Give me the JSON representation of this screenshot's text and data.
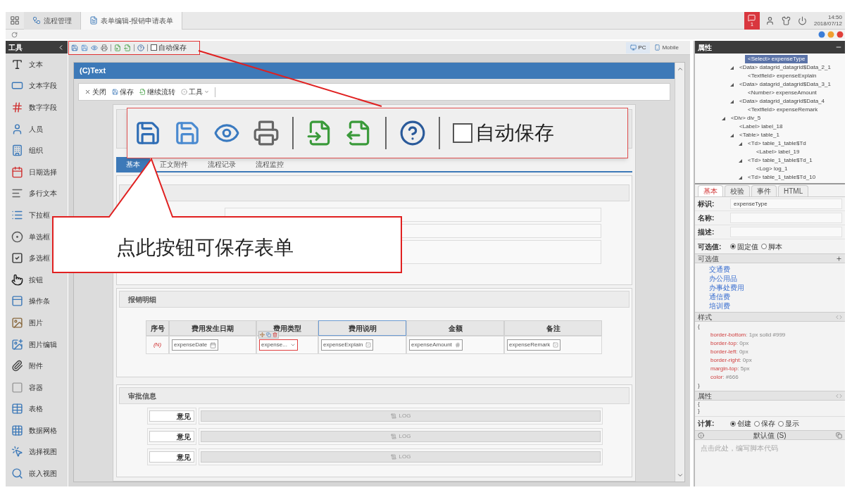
{
  "top_bar": {
    "tabs": [
      {
        "label": "流程管理",
        "selected": false,
        "kind": "flow"
      },
      {
        "label": "表单编辑-报销申请表单",
        "selected": true,
        "kind": "form"
      }
    ],
    "notification_count": "1",
    "time": "14:50",
    "date": "2018/07/12"
  },
  "toolbox": {
    "title": "工具",
    "items": [
      {
        "label": "文本",
        "kind": "text"
      },
      {
        "label": "文本字段",
        "kind": "textfield"
      },
      {
        "label": "数字字段",
        "kind": "number"
      },
      {
        "label": "人员",
        "kind": "person"
      },
      {
        "label": "组织",
        "kind": "org"
      },
      {
        "label": "日期选择",
        "kind": "date"
      },
      {
        "label": "多行文本",
        "kind": "textarea"
      },
      {
        "label": "下拉框",
        "kind": "dropdown"
      },
      {
        "label": "单选框",
        "kind": "radio"
      },
      {
        "label": "多选框",
        "kind": "checkbox"
      },
      {
        "label": "按钮",
        "kind": "button"
      },
      {
        "label": "操作条",
        "kind": "actionbar"
      },
      {
        "label": "图片",
        "kind": "image"
      },
      {
        "label": "图片编辑",
        "kind": "imageedit"
      },
      {
        "label": "附件",
        "kind": "attachment"
      },
      {
        "label": "容器",
        "kind": "container"
      },
      {
        "label": "表格",
        "kind": "table"
      },
      {
        "label": "数据网格",
        "kind": "datagrid"
      },
      {
        "label": "选择视图",
        "kind": "selectview"
      },
      {
        "label": "嵌入视图",
        "kind": "embedview"
      }
    ]
  },
  "editor_toolbar": {
    "auto_save": {
      "label": "自动保存",
      "checked": false
    },
    "views": [
      {
        "label": "PC",
        "selected": true
      },
      {
        "label": "Mobile",
        "selected": false
      }
    ]
  },
  "form": {
    "title": "(C)Text",
    "actions": [
      {
        "label": "关闭",
        "kind": "close"
      },
      {
        "label": "保存",
        "kind": "save"
      },
      {
        "label": "继续流转",
        "kind": "flow"
      },
      {
        "label": "工具",
        "kind": "menu"
      }
    ],
    "tabs": [
      {
        "label": "基本",
        "selected": true
      },
      {
        "label": "正文附件",
        "selected": false
      },
      {
        "label": "流程记录",
        "selected": false
      },
      {
        "label": "流程监控",
        "selected": false
      }
    ],
    "detail": {
      "title": "报销明细",
      "columns": [
        {
          "label": "序号",
          "selected": false
        },
        {
          "label": "费用发生日期",
          "selected": false
        },
        {
          "label": "费用类型",
          "selected": false
        },
        {
          "label": "费用说明",
          "selected": true
        },
        {
          "label": "金额",
          "selected": false
        },
        {
          "label": "备注",
          "selected": false
        }
      ],
      "row": [
        {
          "kind": "index",
          "value": "(N)"
        },
        {
          "kind": "date",
          "value": "expenseDate",
          "selected": false
        },
        {
          "kind": "select",
          "value": "expense...",
          "selected": true
        },
        {
          "kind": "text",
          "value": "expenseExplain",
          "selected": false
        },
        {
          "kind": "number",
          "value": "expenseAmount",
          "selected": false
        },
        {
          "kind": "text",
          "value": "expenseRemark",
          "selected": false
        }
      ]
    },
    "approval": {
      "title": "审批信息",
      "rows": [
        {
          "label": "意见",
          "log": "LOG"
        },
        {
          "label": "意见",
          "log": "LOG"
        },
        {
          "label": "意见",
          "log": "LOG"
        }
      ]
    }
  },
  "properties": {
    "title": "属性",
    "tree": [
      {
        "children": [
          {
            "children": [
              {
                "label": "<Select> expenseType",
                "selected": true,
                "expanded": false
              }
            ]
          },
          {
            "label": "<Data> datagrid_datagrid$Data_2_1",
            "selected": false,
            "expanded": true,
            "children": [
              {
                "label": "<Textfield> expenseExplain",
                "selected": false,
                "expanded": false
              }
            ]
          },
          {
            "label": "<Data> datagrid_datagrid$Data_3_1",
            "selected": false,
            "expanded": true,
            "children": [
              {
                "label": "<Number> expenseAmount",
                "selected": false,
                "expanded": false
              }
            ]
          },
          {
            "label": "<Data> datagrid_datagrid$Data_4",
            "selected": false,
            "expanded": true,
            "children": [
              {
                "label": "<Textfield> expenseRemark",
                "selected": false,
                "expanded": false
              }
            ]
          }
        ]
      },
      {
        "label": "<Div> div_5",
        "selected": false,
        "expanded": true,
        "children": [
          {
            "label": "<Label> label_18",
            "selected": false,
            "expanded": false
          },
          {
            "label": "<Table> table_1",
            "selected": false,
            "expanded": true,
            "children": [
              {
                "label": "<Td> table_1_table$Td",
                "selected": false,
                "expanded": true,
                "children": [
                  {
                    "label": "<Label> label_19",
                    "selected": false,
                    "expanded": false
                  }
                ]
              },
              {
                "label": "<Td> table_1_table$Td_1",
                "selected": false,
                "expanded": true,
                "children": [
                  {
                    "label": "<Log> log_1",
                    "selected": false,
                    "expanded": false
                  }
                ]
              },
              {
                "label": "<Td> table_1_table$Td_10",
                "selected": false,
                "expanded": true
              }
            ]
          }
        ]
      }
    ],
    "tabs": [
      {
        "label": "基本",
        "selected": true
      },
      {
        "label": "校验",
        "selected": false
      },
      {
        "label": "事件",
        "selected": false
      },
      {
        "label": "HTML",
        "selected": false
      }
    ],
    "fields": [
      {
        "label": "标识:",
        "value": "expenseType"
      },
      {
        "label": "名称:"
      },
      {
        "label": "描述:"
      }
    ],
    "source": {
      "label": "可选值:",
      "options": [
        {
          "label": "固定值",
          "selected": true
        },
        {
          "label": "脚本",
          "selected": false
        }
      ]
    },
    "values": {
      "title": "可选值",
      "items": [
        "交通费",
        "办公用品",
        "办事处费用",
        "通信费",
        "培训费"
      ]
    },
    "style": {
      "title": "样式",
      "open": "{",
      "close": "}",
      "rules": [
        {
          "property": "border-bottom",
          "value": ": 1px solid #999"
        },
        {
          "property": "border-top",
          "value": ": 0px"
        },
        {
          "property": "border-left",
          "value": ": 0px"
        },
        {
          "property": "border-right",
          "value": ": 0px"
        },
        {
          "property": "margin-top",
          "value": ": 5px"
        },
        {
          "property": "color",
          "value": ": #666"
        }
      ]
    },
    "attributes": {
      "title": "属性",
      "open": "{",
      "close": "}"
    },
    "calc": {
      "label": "计算:",
      "options": [
        {
          "label": "创建",
          "selected": true
        },
        {
          "label": "保存",
          "selected": false
        },
        {
          "label": "显示",
          "selected": false
        }
      ]
    },
    "default": {
      "title": "默认值 (S)",
      "placeholder": "点击此处，编写脚本代码"
    }
  },
  "callout": {
    "auto_save": {
      "label": "自动保存",
      "checked": false
    },
    "text": "点此按钮可保存表单"
  }
}
